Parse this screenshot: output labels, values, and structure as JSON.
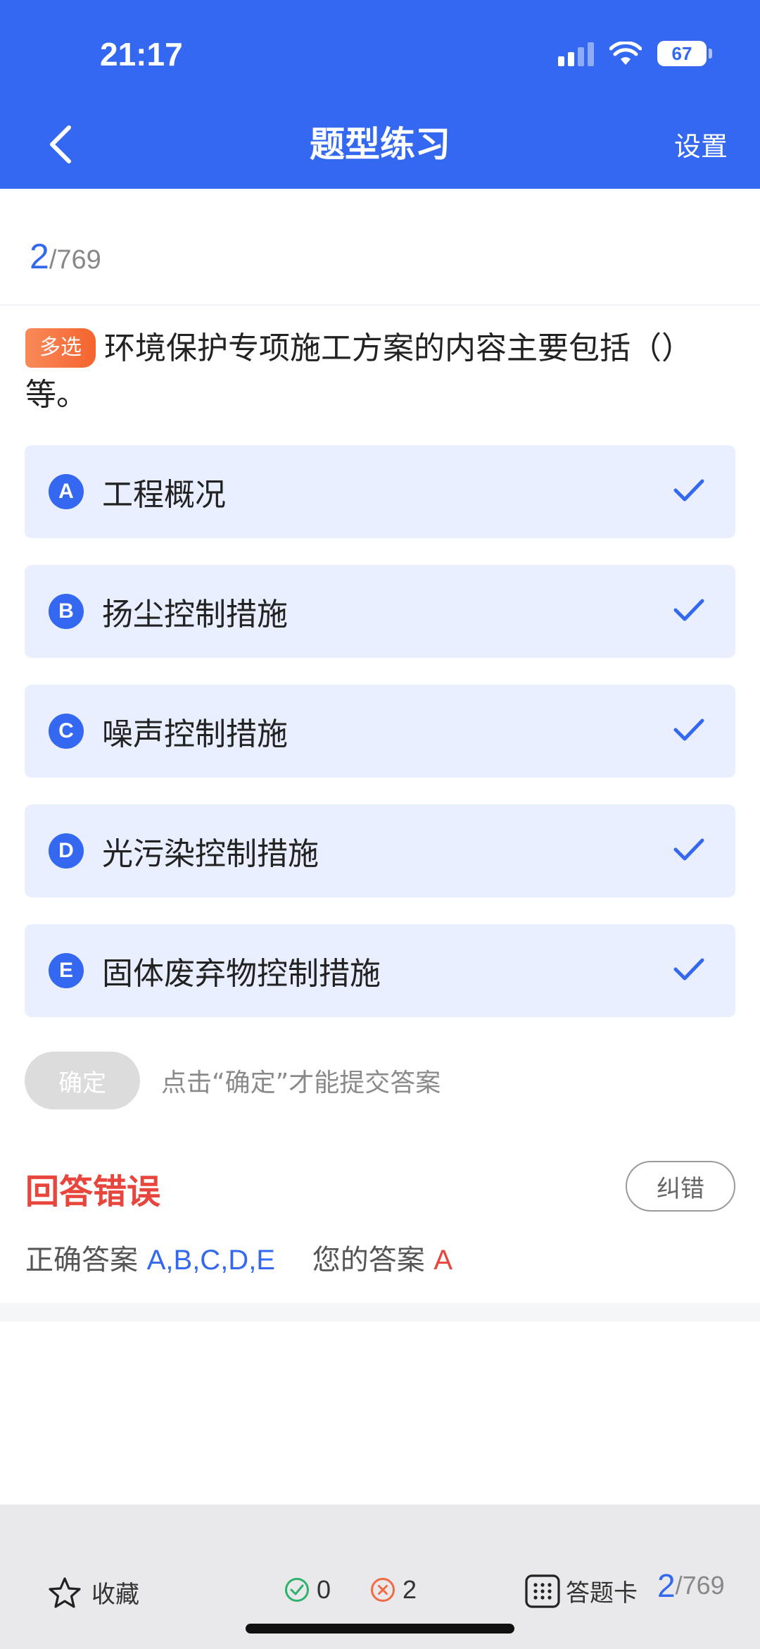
{
  "status_bar": {
    "time": "21:17",
    "battery": "67"
  },
  "nav": {
    "title": "题型练习",
    "settings_label": "设置"
  },
  "progress": {
    "current": "2",
    "total": "/769"
  },
  "question": {
    "type_tag": "多选",
    "text": "环境保护专项施工方案的内容主要包括（）等。"
  },
  "options": [
    {
      "letter": "A",
      "text": "工程概况",
      "checked": true
    },
    {
      "letter": "B",
      "text": "扬尘控制措施",
      "checked": true
    },
    {
      "letter": "C",
      "text": "噪声控制措施",
      "checked": true
    },
    {
      "letter": "D",
      "text": "光污染控制措施",
      "checked": true
    },
    {
      "letter": "E",
      "text": "固体废弃物控制措施",
      "checked": true
    }
  ],
  "confirm": {
    "button_label": "确定",
    "hint": "点击“确定”才能提交答案"
  },
  "result": {
    "title": "回答错误",
    "report_label": "纠错",
    "correct_label": "正确答案",
    "correct_value": "A,B,C,D,E",
    "yours_label": "您的答案",
    "yours_value": "A"
  },
  "bottom_bar": {
    "favorite_label": "收藏",
    "right_count": "0",
    "wrong_count": "2",
    "answer_card_label": "答题卡",
    "current": "2",
    "total": "/769"
  },
  "colors": {
    "primary": "#3468f0",
    "error": "#e8453c",
    "success": "#2fb36b",
    "tag": "#f4642e",
    "option_bg": "#e9efff"
  },
  "icons": [
    "back-chevron-icon",
    "signal-icon",
    "wifi-icon",
    "battery-icon",
    "check-icon",
    "star-icon",
    "check-circle-icon",
    "x-circle-icon",
    "grid-icon"
  ]
}
